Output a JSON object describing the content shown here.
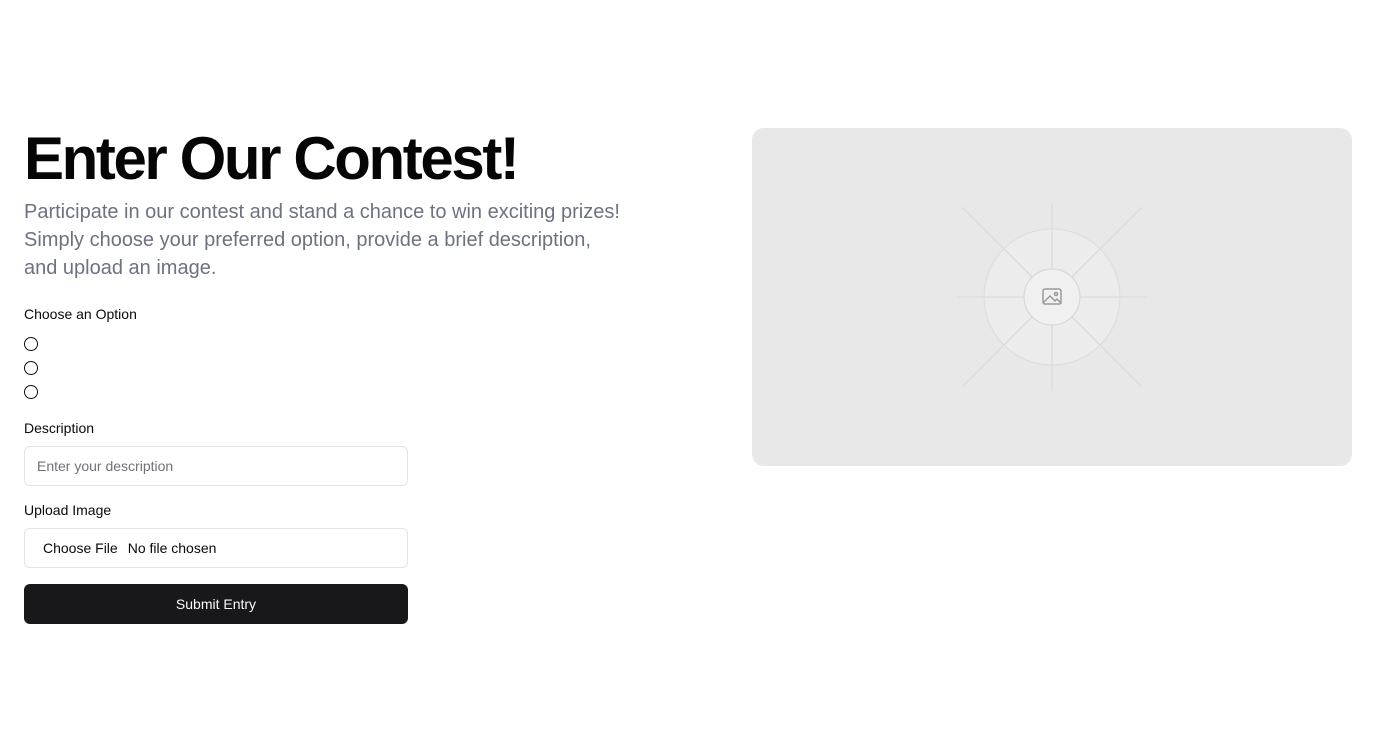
{
  "hero": {
    "title": "Enter Our Contest!",
    "subtitle": "Participate in our contest and stand a chance to win exciting prizes! Simply choose your preferred option, provide a brief description, and upload an image."
  },
  "form": {
    "option_label": "Choose an Option",
    "options": [
      "",
      "",
      ""
    ],
    "description_label": "Description",
    "description_placeholder": "Enter your description",
    "description_value": "",
    "upload_label": "Upload Image",
    "file_button_label": "Choose File",
    "file_status": "No file chosen",
    "submit_label": "Submit Entry"
  },
  "image_placeholder": {
    "icon": "image-icon",
    "background_color": "#e8e8e8"
  },
  "colors": {
    "primary_button": "#18181b",
    "muted_text": "#6b7280"
  }
}
